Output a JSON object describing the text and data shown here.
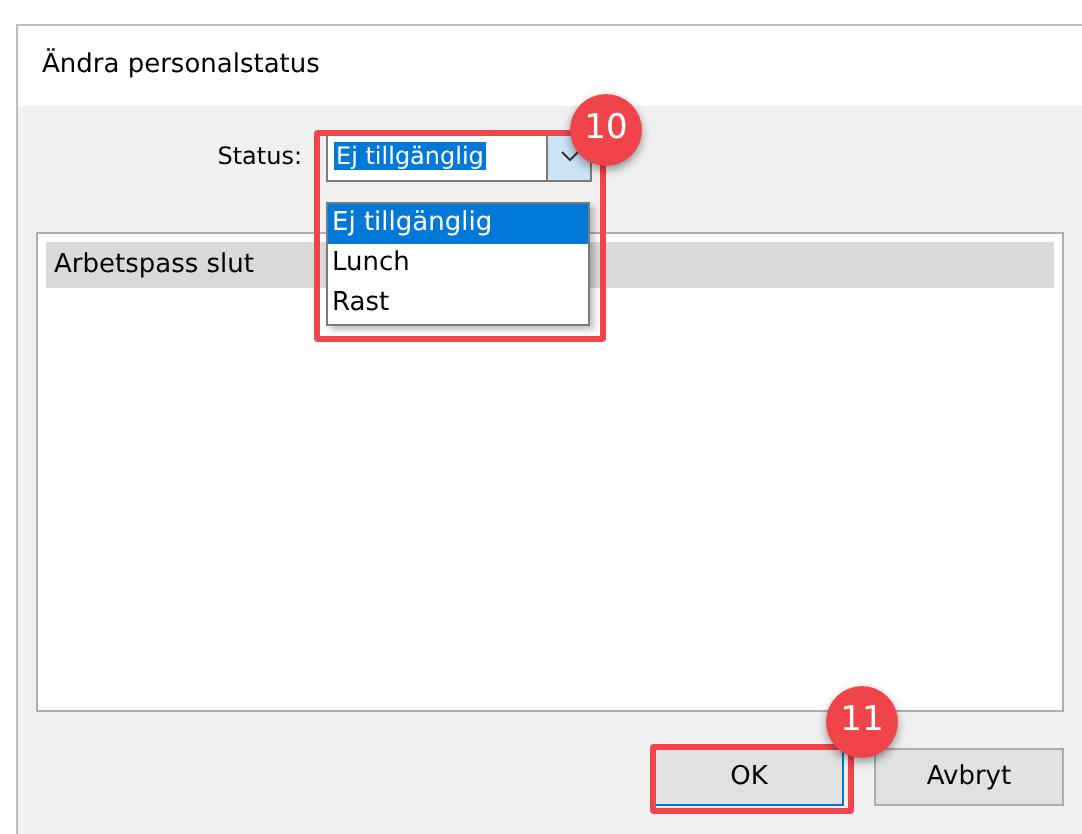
{
  "dialog": {
    "title": "Ändra personalstatus"
  },
  "status": {
    "label": "Status:",
    "value": "Ej tillgänglig",
    "open": true,
    "options": [
      {
        "label": "Ej tillgänglig",
        "selected": true
      },
      {
        "label": "Lunch",
        "selected": false
      },
      {
        "label": "Rast",
        "selected": false
      }
    ]
  },
  "list": {
    "items": [
      {
        "label": "Arbetspass slut",
        "selected": true
      }
    ]
  },
  "buttons": [
    {
      "label": "OK",
      "kind": "default"
    },
    {
      "label": "Avbryt",
      "kind": "normal"
    }
  ],
  "callouts": [
    {
      "number": "10"
    },
    {
      "number": "11"
    }
  ]
}
